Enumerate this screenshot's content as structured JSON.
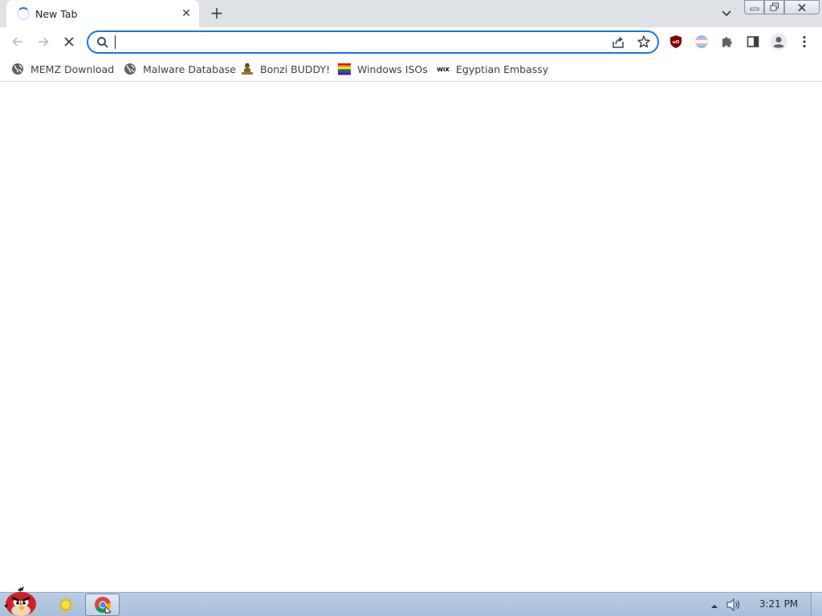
{
  "browser": {
    "tab": {
      "title": "New Tab",
      "close_glyph": "✕",
      "state": "loading"
    },
    "new_tab_glyph": "+",
    "omnibox": {
      "value": "",
      "placeholder": ""
    },
    "icons": {
      "back": "arrow-left-icon",
      "forward": "arrow-right-icon",
      "stop": "stop-loading-icon",
      "share": "share-icon",
      "bookmark": "star-icon",
      "extensions": [
        "ublock-origin-icon",
        "transgender-flag-extension-icon",
        "puzzle-extensions-icon"
      ],
      "side_panel": "side-panel-icon",
      "profile": "profile-avatar-icon",
      "menu": "kebab-menu-icon"
    },
    "bookmarks": [
      {
        "label": "MEMZ Download",
        "icon": "globe-icon"
      },
      {
        "label": "Malware Database",
        "icon": "globe-icon"
      },
      {
        "label": "Bonzi BUDDY!",
        "icon": "bonzi-icon"
      },
      {
        "label": "Windows ISOs",
        "icon": "rainbow-flag-icon"
      },
      {
        "label": "Egyptian Embassy",
        "icon": "wix-icon"
      }
    ]
  },
  "taskbar": {
    "clock": "3:21 PM",
    "start_icon": "angry-bird-start-icon",
    "apps": [
      {
        "name": "explorer",
        "icon": "folder-sun-icon",
        "active": false
      },
      {
        "name": "chrome",
        "icon": "chrome-icon",
        "active": true
      }
    ]
  },
  "colors": {
    "accent": "#1a73e8",
    "tabstrip": "#dee1e6",
    "ublock": "#800000",
    "taskbar": "#a7bfd9"
  }
}
